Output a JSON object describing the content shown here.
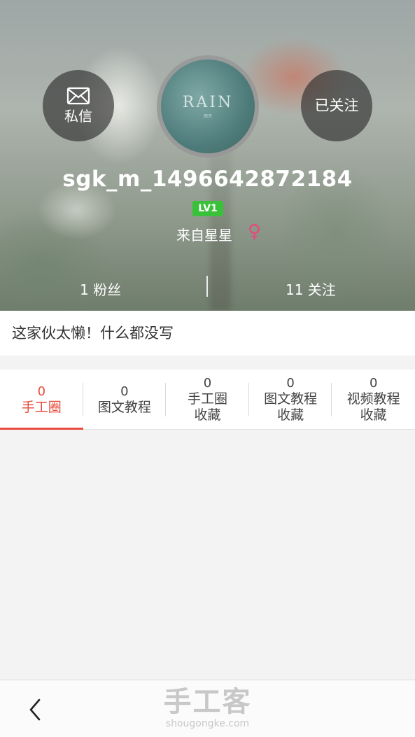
{
  "header": {
    "message_button": {
      "icon": "envelope-icon",
      "label": "私信"
    },
    "follow_button": {
      "label": "已关注"
    },
    "avatar": {
      "text": "RAIN",
      "subtext": "雨天"
    },
    "username": "sgk_m_1496642872184",
    "level": "LV1",
    "location": "来自星星",
    "gender_icon": "female-icon",
    "stats": {
      "fans": "1 粉丝",
      "following": "11 关注"
    }
  },
  "bio": "这家伙太懒！什么都没写",
  "tabs": [
    {
      "count": "0",
      "label_line1": "手工圈",
      "label_line2": "",
      "active": true
    },
    {
      "count": "0",
      "label_line1": "图文教程",
      "label_line2": "",
      "active": false
    },
    {
      "count": "0",
      "label_line1": "手工圈",
      "label_line2": "收藏",
      "active": false
    },
    {
      "count": "0",
      "label_line1": "图文教程",
      "label_line2": "收藏",
      "active": false
    },
    {
      "count": "0",
      "label_line1": "视频教程",
      "label_line2": "收藏",
      "active": false
    }
  ],
  "bottom_bar": {
    "back_icon": "chevron-left-icon",
    "logo_cn": "手工客",
    "logo_en": "shougongke.com"
  },
  "colors": {
    "accent": "#e84a3c",
    "level_badge": "#39c239",
    "female": "#e8487a"
  }
}
